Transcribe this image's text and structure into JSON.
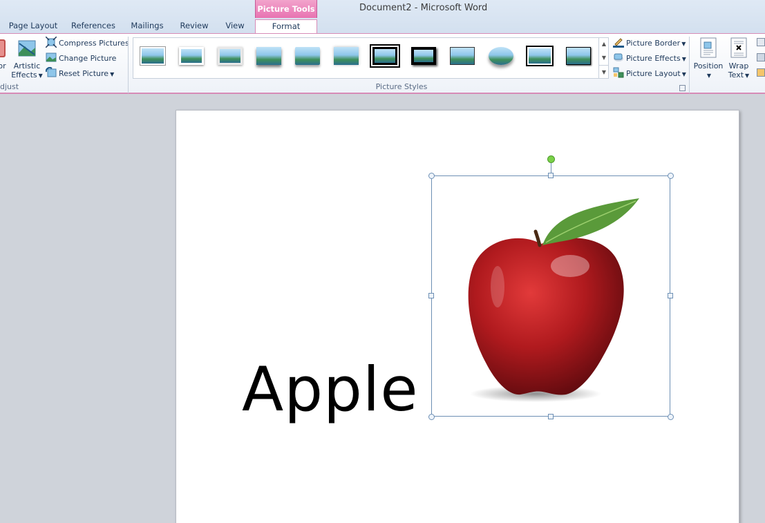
{
  "window": {
    "title": "Document2  -  Microsoft Word"
  },
  "context_tab_group": "Picture Tools",
  "tabs": [
    "Page Layout",
    "References",
    "Mailings",
    "Review",
    "View",
    "Format"
  ],
  "active_tab": "Format",
  "ribbon": {
    "adjust": {
      "label": "djust",
      "color_label_fragment": "or",
      "artistic_effects_line1": "Artistic",
      "artistic_effects_line2": "Effects",
      "compress_pictures": "Compress Pictures",
      "change_picture": "Change Picture",
      "reset_picture": "Reset Picture"
    },
    "picture_styles": {
      "label": "Picture Styles",
      "thumbnail_count": 12,
      "picture_border": "Picture Border",
      "picture_effects": "Picture Effects",
      "picture_layout": "Picture Layout"
    },
    "arrange": {
      "position": "Position",
      "wrap_text_line1": "Wrap",
      "wrap_text_line2": "Text"
    }
  },
  "document": {
    "text": "Apple",
    "image_subject": "red apple with leaf"
  },
  "colors": {
    "accent_pink": "#e873b1",
    "ribbon_border": "#d78bb7",
    "text": "#1e395b"
  }
}
